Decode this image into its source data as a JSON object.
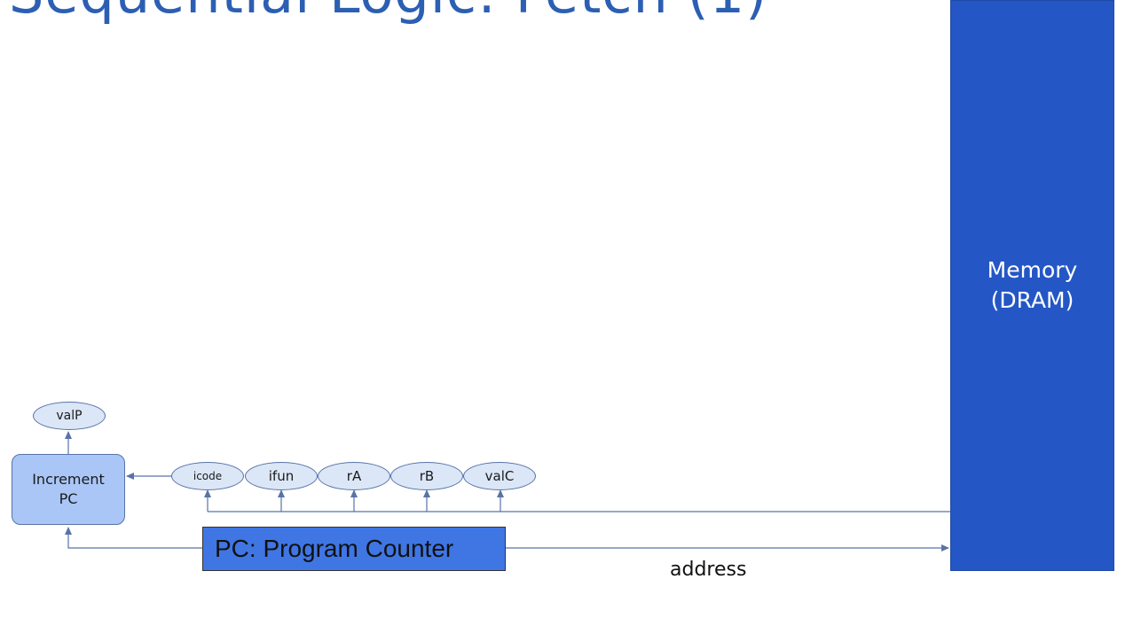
{
  "slide": {
    "title_partial": "Sequential Logic: Fetch (1)"
  },
  "memory": {
    "label": "Memory\n(DRAM)"
  },
  "increment_pc": {
    "label": "Increment\nPC"
  },
  "pc_register": {
    "label": "PC: Program Counter"
  },
  "outputs": {
    "valP": "valP",
    "icode": "icode",
    "ifun": "ifun",
    "rA": "rA",
    "rB": "rB",
    "valC": "valC"
  },
  "wire_labels": {
    "address": "address"
  },
  "colors": {
    "memory_fill": "#2457c5",
    "pc_fill": "#3f76e4",
    "increment_fill": "#a9c6f6",
    "oval_fill": "#dbe6f7",
    "wire": "#5873a8"
  }
}
